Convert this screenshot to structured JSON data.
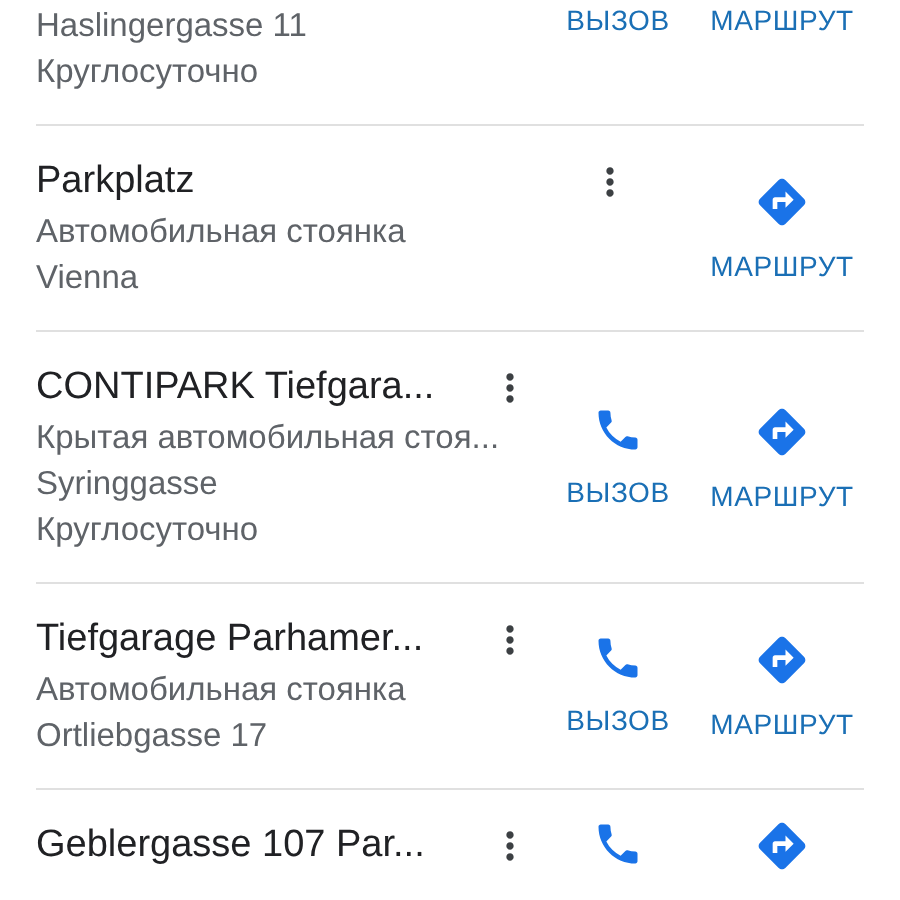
{
  "places": [
    {
      "lines": [
        "Haslingergasse 11",
        "Круглосуточно"
      ],
      "actions": [
        {
          "kind": "call",
          "label": "ВЫЗОВ"
        },
        {
          "kind": "route",
          "label": "МАРШРУТ"
        }
      ]
    },
    {
      "title": "Parkplatz",
      "lines": [
        "Автомобильная стоянка",
        "Vienna"
      ],
      "actions": [
        {
          "kind": "route",
          "label": "МАРШРУТ"
        }
      ]
    },
    {
      "title": "CONTIPARK Tiefgara...",
      "lines": [
        "Крытая автомобильная стоя...",
        "Syringgasse",
        "Круглосуточно"
      ],
      "actions": [
        {
          "kind": "call",
          "label": "ВЫЗОВ"
        },
        {
          "kind": "route",
          "label": "МАРШРУТ"
        }
      ]
    },
    {
      "title": "Tiefgarage Parhamer...",
      "lines": [
        "Автомобильная стоянка",
        "Ortliebgasse 17"
      ],
      "actions": [
        {
          "kind": "call",
          "label": "ВЫЗОВ"
        },
        {
          "kind": "route",
          "label": "МАРШРУТ"
        }
      ]
    },
    {
      "title": "Geblergasse 107 Par...",
      "actions": [
        {
          "kind": "call"
        },
        {
          "kind": "route"
        }
      ]
    }
  ]
}
